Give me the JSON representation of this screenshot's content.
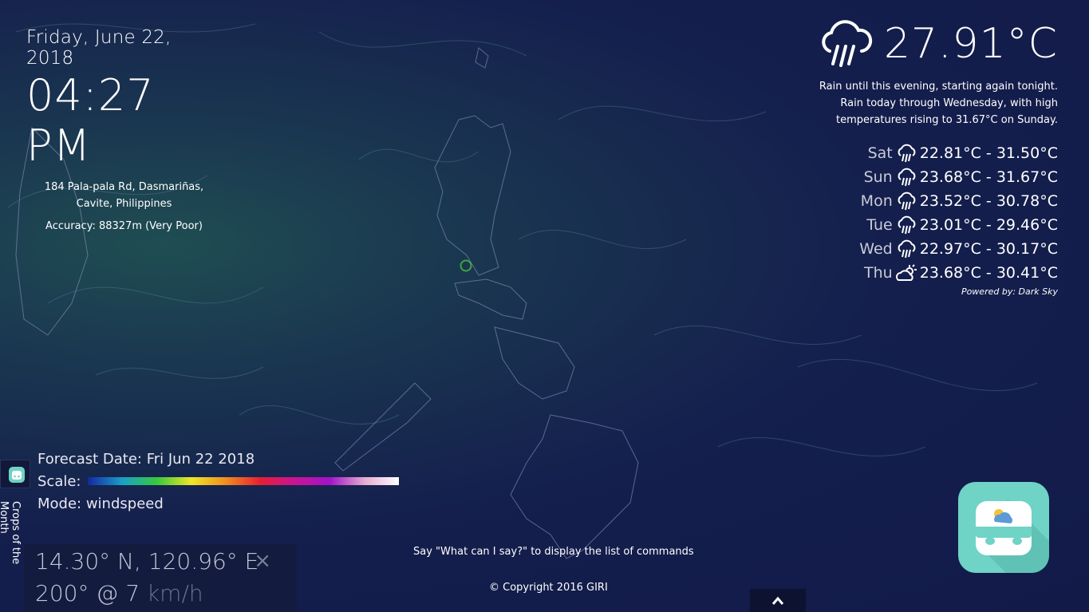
{
  "clock": {
    "date": "Friday, June 22, 2018",
    "time": "04:27 PM"
  },
  "location": {
    "address": "184 Pala-pala Rd, Dasmariñas, Cavite, Philippines",
    "accuracy": "Accuracy: 88327m (Very Poor)"
  },
  "weather": {
    "current_temp": "27.91°C",
    "current_icon": "rain-cloud-icon",
    "summary": "Rain until this evening, starting again tonight. Rain today through Wednesday, with high temperatures rising to 31.67°C on Sunday.",
    "forecast": [
      {
        "day": "Sat",
        "icon": "rain-cloud-icon",
        "range": "22.81°C - 31.50°C"
      },
      {
        "day": "Sun",
        "icon": "rain-cloud-icon",
        "range": "23.68°C - 31.67°C"
      },
      {
        "day": "Mon",
        "icon": "rain-cloud-icon",
        "range": "23.52°C - 30.78°C"
      },
      {
        "day": "Tue",
        "icon": "rain-cloud-icon",
        "range": "23.01°C - 29.46°C"
      },
      {
        "day": "Wed",
        "icon": "rain-cloud-icon",
        "range": "22.97°C - 30.17°C"
      },
      {
        "day": "Thu",
        "icon": "partly-cloudy-icon",
        "range": "23.68°C - 30.41°C"
      }
    ],
    "powered_by": "Powered by: Dark Sky"
  },
  "legend": {
    "forecast_date": "Forecast Date: Fri Jun 22 2018",
    "scale_label": "Scale:",
    "mode": "Mode: windspeed"
  },
  "sidebar": {
    "vertical_label": "Crops of the Month"
  },
  "coords": {
    "position": "14.30° N, 120.96° E",
    "wind_value": "200° @ 7 ",
    "wind_unit": "km/h",
    "close": "×"
  },
  "footer": {
    "hint": "Say \"What can I say?\" to display the list of commands",
    "copyright": "© Copyright 2016 GIRI",
    "up_icon": "chevron-up-icon"
  },
  "colors": {
    "background": "#141f4d",
    "accent": "#6fd3c5",
    "marker": "#3fa63a"
  }
}
